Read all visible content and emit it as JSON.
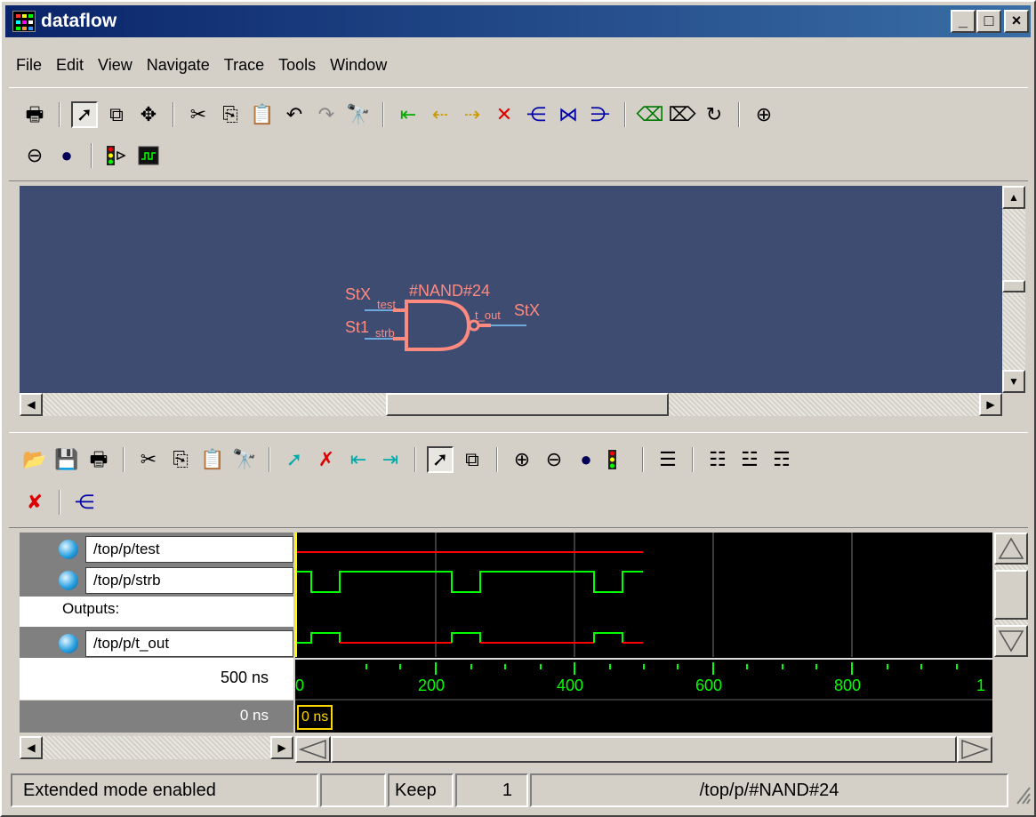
{
  "window": {
    "title": "dataflow"
  },
  "menu": [
    "File",
    "Edit",
    "View",
    "Navigate",
    "Trace",
    "Tools",
    "Window"
  ],
  "dataflow": {
    "gate_name": "#NAND#24",
    "input1_value": "StX",
    "input1_port": "test",
    "input2_value": "St1",
    "input2_port": "strb",
    "output_port": "t_out",
    "output_value": "StX"
  },
  "wave": {
    "signals": [
      "/top/p/test",
      "/top/p/strb",
      "Outputs:",
      "/top/p/t_out"
    ],
    "now_label": "500 ns",
    "cursor_label": "0 ns",
    "cursor_marker": "0 ns",
    "ticks": [
      "0",
      "200",
      "400",
      "600",
      "800",
      "1"
    ]
  },
  "status": {
    "message": "Extended mode enabled",
    "keep_label": "Keep",
    "keep_value": "1",
    "path": "/top/p/#NAND#24"
  },
  "colors": {
    "canvas_bg": "#3e4c72",
    "gate": "#ff8a80",
    "wave_green": "#00ff00",
    "wave_red": "#ff0000"
  }
}
